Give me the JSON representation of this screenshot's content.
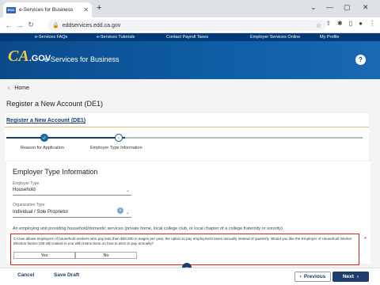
{
  "browser": {
    "tab_title": "e-Services for Business",
    "tab_favicon_text": "EDD",
    "url": "eddservices.edd.ca.gov",
    "new_tab": "+",
    "window_controls": [
      "⌄",
      "—",
      "▢",
      "✕"
    ]
  },
  "site_nav": {
    "items": [
      "e-Services FAQs",
      "e-Services Tutorials",
      "Contact Payroll Taxes",
      "Employer Services Online",
      "My Profile"
    ]
  },
  "header": {
    "logo_ca": "CA",
    "logo_gov": ".GOV",
    "title": "e-Services for Business",
    "help": "?"
  },
  "breadcrumb": {
    "home": "Home"
  },
  "page": {
    "heading": "Register a New Account (DE1)",
    "card_title": "Register a New Account (DE1)"
  },
  "stepper": {
    "steps": [
      "Reason for Application",
      "Employer Type Information"
    ]
  },
  "form": {
    "title": "Employer Type Information",
    "employer_type_label": "Employer Type",
    "employer_type_value": "Household",
    "org_type_label": "Organization Type",
    "org_type_value": "Individual / Sole Proprietor",
    "description": "An employing unit providing household/domestic services (private home, local college club, or local chapter of a college fraternity or sorority).",
    "question": "CA law allows employers of household workers who pay less than $20,000 in wages per year, the option to pay employment taxes annually instead of quarterly. Would you like the Employer of Household Worker Election Notice (DE 88) mailed to you with instructions on how to elect to pay annually?",
    "yes": "Yes",
    "no": "No",
    "required": "*"
  },
  "footer": {
    "cancel": "Cancel",
    "save_draft": "Save Draft",
    "previous": "Previous",
    "next": "Next"
  }
}
